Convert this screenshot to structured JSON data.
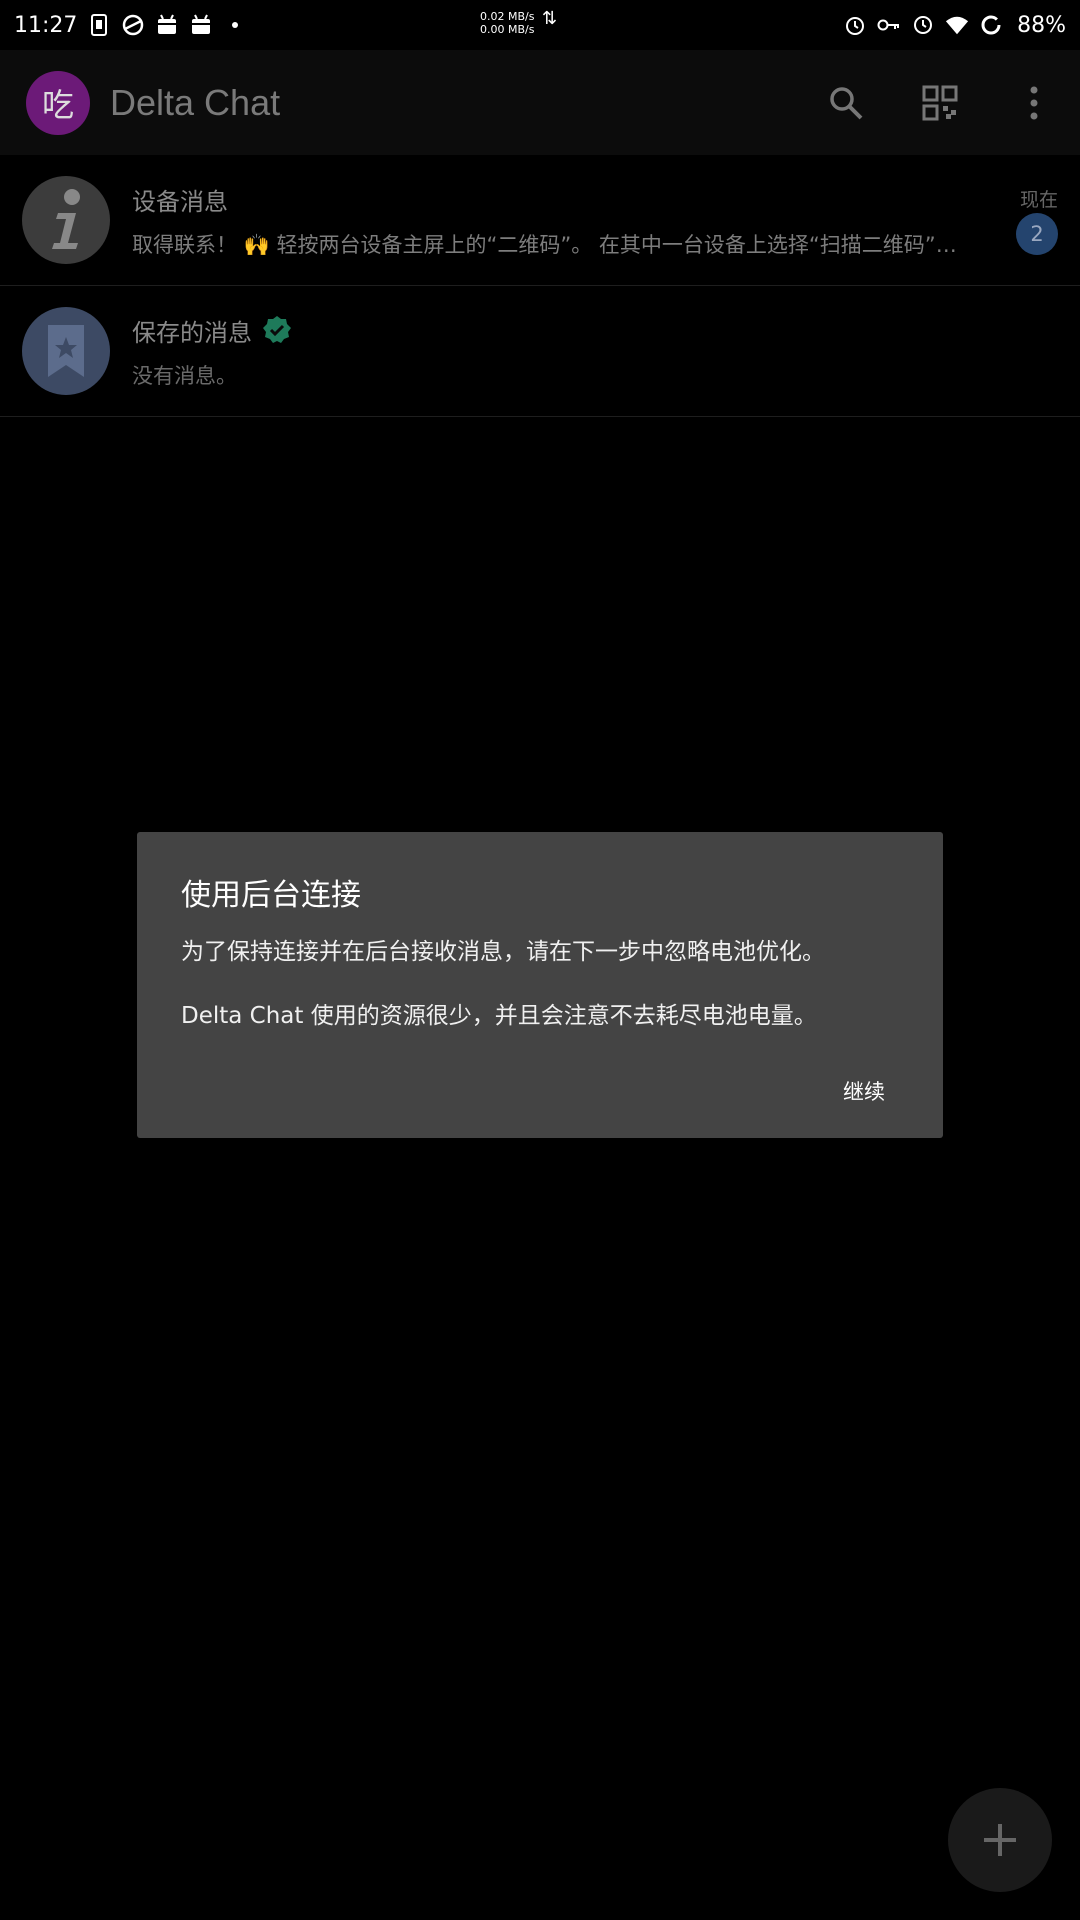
{
  "status_bar": {
    "time": "11:27",
    "net_up": "0.02 MB/s",
    "net_down": "0.00 MB/s",
    "battery": "88%"
  },
  "app_bar": {
    "avatar_letter": "吃",
    "title": "Delta Chat",
    "avatar_color": "#6c1a78"
  },
  "chats": [
    {
      "name": "设备消息",
      "preview": "取得联系！ 🙌 轻按两台设备主屏上的“二维码”。 在其中一台设备上选择“扫描二维码”…",
      "time": "现在",
      "unread": "2"
    },
    {
      "name": "保存的消息",
      "preview": "没有消息。"
    }
  ],
  "dialog": {
    "title": "使用后台连接",
    "message_1": "为了保持连接并在后台接收消息，请在下一步中忽略电池优化。",
    "message_2": "Delta Chat 使用的资源很少，并且会注意不去耗尽电池电量。",
    "continue_label": "继续"
  },
  "colors": {
    "verified_badge": "#1e7a5a",
    "unread_badge": "#24446e",
    "dialog_bg": "#444444"
  }
}
